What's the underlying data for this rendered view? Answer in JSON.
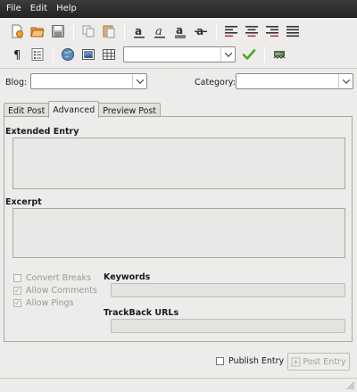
{
  "menubar": {
    "items": [
      "File",
      "Edit",
      "Help"
    ]
  },
  "toolbar": {
    "format_select_value": "",
    "icons": [
      "new-document-icon",
      "open-folder-icon",
      "save-icon",
      "copy-icon",
      "paste-icon",
      "bold-icon",
      "italic-icon",
      "underline-icon",
      "strikethrough-icon",
      "align-left-icon",
      "align-center-icon",
      "align-right-icon",
      "align-justify-icon",
      "paragraph-icon",
      "list-icon",
      "globe-link-icon",
      "image-icon",
      "table-icon",
      "apply-check-icon",
      "spellcheck-icon"
    ]
  },
  "blog": {
    "label": "Blog:",
    "value": ""
  },
  "category": {
    "label": "Category:",
    "value": ""
  },
  "tabs": [
    {
      "label": "Edit Post",
      "active": false
    },
    {
      "label": "Advanced",
      "active": true
    },
    {
      "label": "Preview Post",
      "active": false
    }
  ],
  "advanced": {
    "extended_entry_label": "Extended Entry",
    "excerpt_label": "Excerpt",
    "options": {
      "convert_breaks": "Convert Breaks",
      "allow_comments": "Allow Comments",
      "allow_pings": "Allow Pings",
      "allow_comments_checked": "✓",
      "allow_pings_checked": "✓"
    },
    "keywords_label": "Keywords",
    "trackback_label": "TrackBack URLs"
  },
  "footer": {
    "publish_label": "Publish Entry",
    "post_button_label": "Post Entry"
  },
  "colors": {
    "menubar": "#2e2e2e",
    "background": "#edeceb",
    "disabled_text": "#9a9894",
    "check_green": "#4aa521"
  }
}
